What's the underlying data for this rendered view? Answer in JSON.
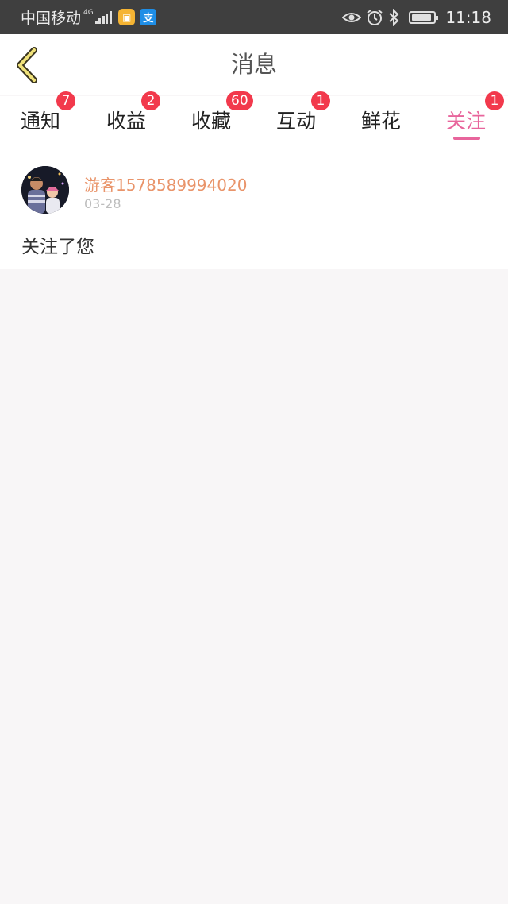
{
  "status_bar": {
    "carrier": "中国移动",
    "network": "4G",
    "time": "11:18",
    "battery_level": 0.9
  },
  "header": {
    "title": "消息",
    "back_icon": "chevron-left-icon"
  },
  "tabs": [
    {
      "label": "通知",
      "badge": "7",
      "active": false
    },
    {
      "label": "收益",
      "badge": "2",
      "active": false
    },
    {
      "label": "收藏",
      "badge": "60",
      "active": false
    },
    {
      "label": "互动",
      "badge": "1",
      "active": false
    },
    {
      "label": "鲜花",
      "badge": "",
      "active": false
    },
    {
      "label": "关注",
      "badge": "1",
      "active": true
    }
  ],
  "messages": [
    {
      "username": "游客1578589994020",
      "date": "03-28",
      "text": "关注了您"
    }
  ],
  "colors": {
    "accent": "#e8659c",
    "badge": "#f2394c",
    "username": "#e9946a",
    "status_bar": "#3f3f3f"
  }
}
